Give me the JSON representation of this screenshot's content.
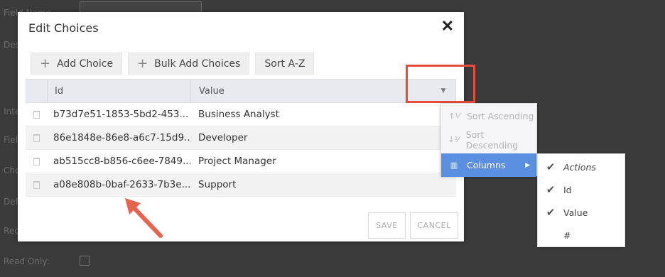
{
  "background_form": {
    "labels": [
      "Field Name",
      "Description",
      "Internal Name",
      "Field Type",
      "Choices",
      "Default Value",
      "Required",
      "Read Only:"
    ]
  },
  "dialog": {
    "title": "Edit Choices",
    "close_icon": "close-icon",
    "toolbar": {
      "add_choice": "Add Choice",
      "bulk_add": "Bulk Add Choices",
      "sort": "Sort A-Z"
    },
    "grid": {
      "columns": [
        "Id",
        "Value"
      ],
      "rows": [
        {
          "id": "b73d7e51-1853-5bd2-453...",
          "value": "Business Analyst"
        },
        {
          "id": "86e1848e-86e8-a6c7-15d9...",
          "value": "Developer"
        },
        {
          "id": "ab515cc8-b856-c6ee-7849...",
          "value": "Project Manager"
        },
        {
          "id": "a08e808b-0baf-2633-7b3e...",
          "value": "Support"
        }
      ]
    },
    "buttons": {
      "save": "SAVE",
      "cancel": "CANCEL"
    }
  },
  "column_menu": {
    "items": [
      {
        "label": "Sort Ascending",
        "icon": "sort-ascending-icon"
      },
      {
        "label": "Sort Descending",
        "icon": "sort-descending-icon"
      },
      {
        "label": "Columns",
        "icon": "columns-icon"
      }
    ],
    "submenu": [
      {
        "label": "Actions",
        "checked": true
      },
      {
        "label": "Id",
        "checked": true
      },
      {
        "label": "Value",
        "checked": true
      },
      {
        "label": "#",
        "checked": false
      }
    ]
  },
  "colors": {
    "accent": "#5b8fe0",
    "annotation": "#e64b3c",
    "overlay": "#3b3b3b"
  }
}
